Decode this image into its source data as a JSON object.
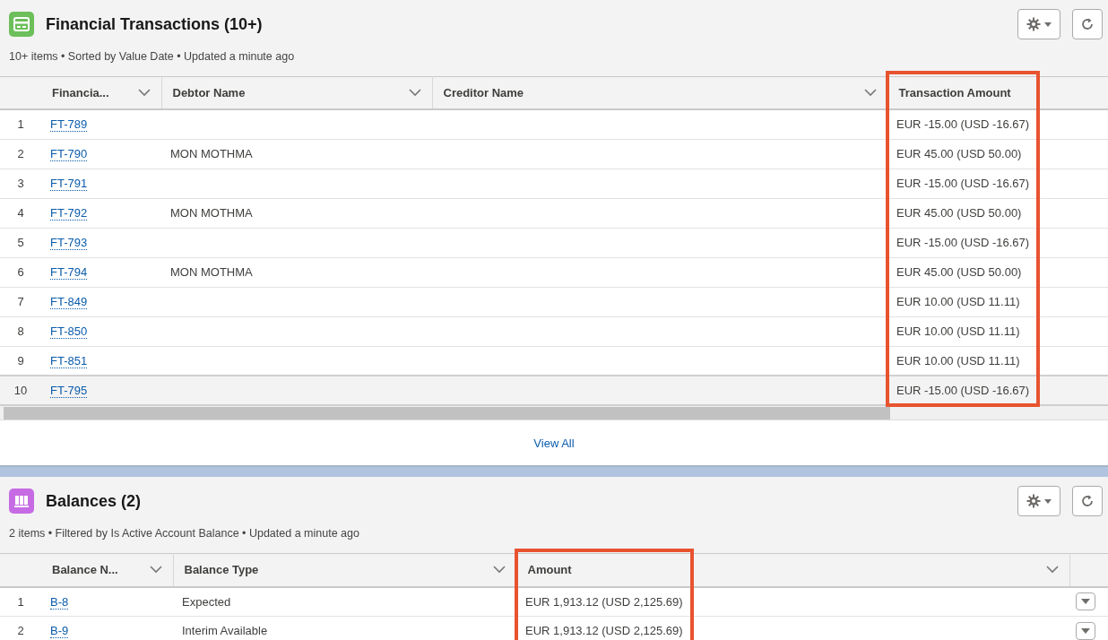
{
  "sections": [
    {
      "title": "Financial Transactions (10+)",
      "subtitle": "10+ items • Sorted by Value Date • Updated a minute ago",
      "scrollable": true,
      "footer_link": "View All",
      "columns": [
        {
          "label": "Financia...",
          "menu": true,
          "highlighted": false
        },
        {
          "label": "Debtor Name",
          "menu": true,
          "highlighted": false
        },
        {
          "label": "Creditor Name",
          "menu": true,
          "highlighted": false
        },
        {
          "label": "Transaction Amount",
          "menu": false,
          "highlighted": true
        }
      ],
      "rows": [
        {
          "number": "1",
          "cells": [
            "FT-789",
            "",
            "",
            "EUR -15.00 (USD -16.67)"
          ],
          "selected": false,
          "row_action": false
        },
        {
          "number": "2",
          "cells": [
            "FT-790",
            "MON MOTHMA",
            "",
            "EUR 45.00 (USD 50.00)"
          ],
          "selected": false,
          "row_action": false
        },
        {
          "number": "3",
          "cells": [
            "FT-791",
            "",
            "",
            "EUR -15.00 (USD -16.67)"
          ],
          "selected": false,
          "row_action": false
        },
        {
          "number": "4",
          "cells": [
            "FT-792",
            "MON MOTHMA",
            "",
            "EUR 45.00 (USD 50.00)"
          ],
          "selected": false,
          "row_action": false
        },
        {
          "number": "5",
          "cells": [
            "FT-793",
            "",
            "",
            "EUR -15.00 (USD -16.67)"
          ],
          "selected": false,
          "row_action": false
        },
        {
          "number": "6",
          "cells": [
            "FT-794",
            "MON MOTHMA",
            "",
            "EUR 45.00 (USD 50.00)"
          ],
          "selected": false,
          "row_action": false
        },
        {
          "number": "7",
          "cells": [
            "FT-849",
            "",
            "",
            "EUR 10.00 (USD 11.11)"
          ],
          "selected": false,
          "row_action": false
        },
        {
          "number": "8",
          "cells": [
            "FT-850",
            "",
            "",
            "EUR 10.00 (USD 11.11)"
          ],
          "selected": false,
          "row_action": false
        },
        {
          "number": "9",
          "cells": [
            "FT-851",
            "",
            "",
            "EUR 10.00 (USD 11.11)"
          ],
          "selected": false,
          "row_action": false
        },
        {
          "number": "10",
          "cells": [
            "FT-795",
            "",
            "",
            "EUR -15.00 (USD -16.67)"
          ],
          "selected": true,
          "row_action": false
        }
      ]
    },
    {
      "title": "Balances (2)",
      "subtitle": "2 items • Filtered by Is Active Account Balance • Updated a minute ago",
      "scrollable": false,
      "columns": [
        {
          "label": "Balance N...",
          "menu": true,
          "highlighted": false
        },
        {
          "label": "Balance Type",
          "menu": true,
          "highlighted": false
        },
        {
          "label": "Amount",
          "menu": true,
          "highlighted": true
        }
      ],
      "rows": [
        {
          "number": "1",
          "cells": [
            "B-8",
            "Expected",
            "EUR 1,913.12 (USD 2,125.69)"
          ],
          "selected": false,
          "row_action": true
        },
        {
          "number": "2",
          "cells": [
            "B-9",
            "Interim Available",
            "EUR 1,913.12 (USD 2,125.69)"
          ],
          "selected": false,
          "row_action": true
        }
      ]
    }
  ]
}
